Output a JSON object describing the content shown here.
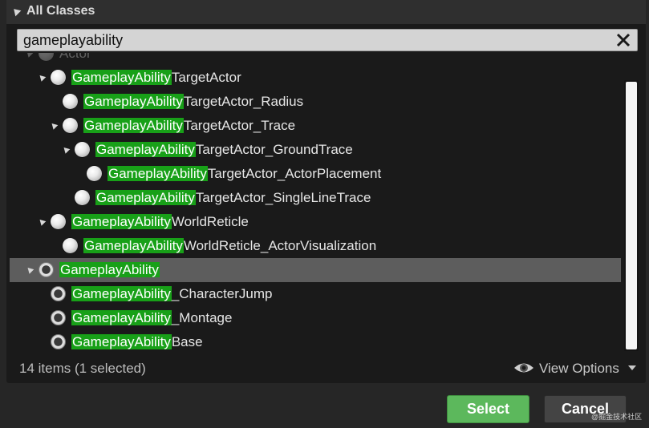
{
  "panel": {
    "title": "All Classes"
  },
  "search": {
    "value": "gameplayability"
  },
  "tree": {
    "rows": [
      {
        "highlight": "",
        "suffix": "Actor",
        "faded": true
      },
      {
        "highlight": "GameplayAbility",
        "suffix": "TargetActor"
      },
      {
        "highlight": "GameplayAbility",
        "suffix": "TargetActor_Radius"
      },
      {
        "highlight": "GameplayAbility",
        "suffix": "TargetActor_Trace"
      },
      {
        "highlight": "GameplayAbility",
        "suffix": "TargetActor_GroundTrace"
      },
      {
        "highlight": "GameplayAbility",
        "suffix": "TargetActor_ActorPlacement"
      },
      {
        "highlight": "GameplayAbility",
        "suffix": "TargetActor_SingleLineTrace"
      },
      {
        "highlight": "GameplayAbility",
        "suffix": "WorldReticle"
      },
      {
        "highlight": "GameplayAbility",
        "suffix": "WorldReticle_ActorVisualization"
      },
      {
        "highlight": "GameplayAbility",
        "suffix": "",
        "selected": true
      },
      {
        "highlight": "GameplayAbility",
        "suffix": "_CharacterJump"
      },
      {
        "highlight": "GameplayAbility",
        "suffix": "_Montage"
      },
      {
        "highlight": "GameplayAbility",
        "suffix": "Base"
      }
    ]
  },
  "footer": {
    "count": "14 items (1 selected)",
    "view_options": "View Options"
  },
  "buttons": {
    "select": "Select",
    "cancel": "Cancel"
  },
  "watermark": "@掘金技术社区",
  "colors": {
    "highlight": "#18a018",
    "select_button": "#5cb85c",
    "selected_row": "#5d5d5d"
  }
}
